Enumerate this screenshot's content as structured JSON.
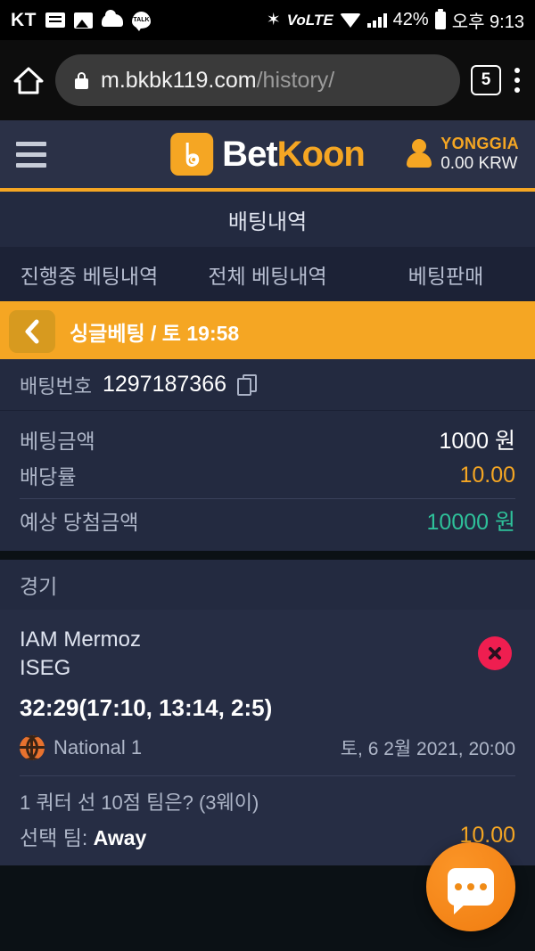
{
  "statusbar": {
    "carrier": "KT",
    "icons": [
      "message-icon",
      "photo-icon",
      "cloud-icon",
      "kakaotalk-icon",
      "bluetooth-icon",
      "volte-icon",
      "wifi-icon",
      "signal-icon",
      "battery-icon"
    ],
    "bluetooth": "✶",
    "volte": "VoLTE",
    "battery_percent": "42%",
    "clock": "오후 9:13"
  },
  "browser": {
    "home_icon": "home-icon",
    "lock_icon": "lock-icon",
    "url_main": "m.bkbk119.com",
    "url_path": "/history/",
    "tab_count": "5",
    "menu_icon": "kebab-menu-icon"
  },
  "header": {
    "menu_icon": "hamburger-icon",
    "brand_first": "Bet",
    "brand_second": "Koon",
    "logo_icon": "betkoon-logo-icon",
    "user_icon": "user-icon",
    "username": "YONGGIA",
    "balance": "0.00 KRW",
    "accent_color": "#f5a623"
  },
  "page": {
    "title": "배팅내역"
  },
  "tabs": [
    {
      "label": "진행중 베팅내역",
      "active": false
    },
    {
      "label": "전체 베팅내역",
      "active": false
    },
    {
      "label": "베팅판매",
      "active": false
    }
  ],
  "banner": {
    "back_icon": "chevron-left-icon",
    "text": "싱글베팅 / 토 19:58"
  },
  "bet": {
    "number_label": "배팅번호",
    "number_value": "1297187366",
    "copy_icon": "copy-icon",
    "stake_label": "베팅금액",
    "stake_value": "1000 원",
    "odds_label": "배당률",
    "odds_value": "10.00",
    "payout_label": "예상 당첨금액",
    "payout_value": "10000 원",
    "odds_color": "#f5a623",
    "payout_color": "#2ec19a"
  },
  "match_section": {
    "header": "경기",
    "home_team": "IAM Mermoz",
    "away_team": "ISEG",
    "score": "32:29(17:10, 13:14, 2:5)",
    "sport_icon": "basketball-icon",
    "league": "National 1",
    "datetime": "토, 6 2월 2021, 20:00",
    "status_icon": "close-x-icon",
    "status_color": "#ef1e50",
    "market": "1 쿼터 선 10점 팀은? (3웨이)",
    "selection_label": "선택 팀: ",
    "selection_value": "Away",
    "selection_odds": "10.00"
  },
  "fab": {
    "icon": "chat-bubble-icon"
  }
}
